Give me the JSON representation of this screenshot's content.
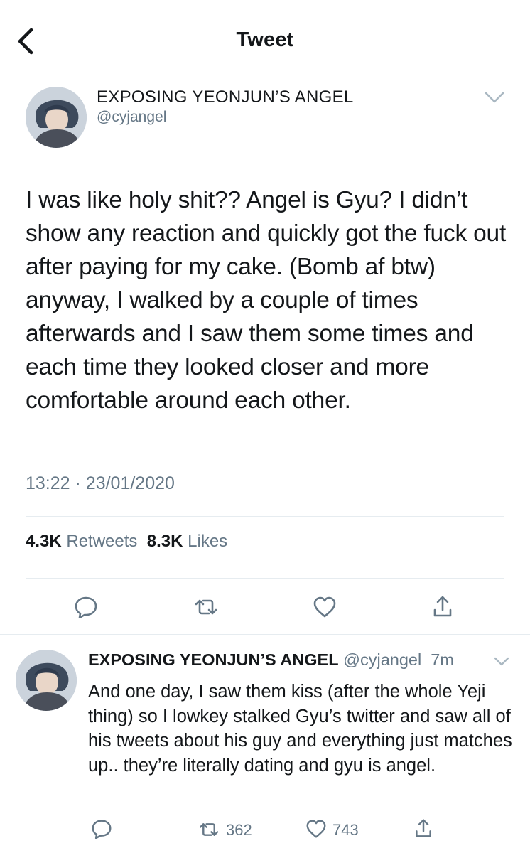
{
  "header": {
    "title": "Tweet",
    "back_icon": "chevron-left-icon"
  },
  "tweet": {
    "author_name": "EXPOSING YEONJUN’S ANGEL",
    "author_handle": "@cyjangel",
    "text": "I was like holy shit?? Angel is Gyu? I didn’t show any reaction and quickly got the fuck out after paying for my cake. (Bomb af btw) anyway, I walked by a couple of times afterwards and I saw them some times and each time they looked closer and more comfortable around each other.",
    "time": "13:22",
    "separator": "·",
    "date": "23/01/2020",
    "retweets_count": "4.3K",
    "retweets_label": "Retweets",
    "likes_count": "8.3K",
    "likes_label": "Likes"
  },
  "reply": {
    "author_name": "EXPOSING YEONJUN’S ANGEL",
    "author_handle": "@cyjangel",
    "time": "7m",
    "text": "And one day, I saw them kiss (after the whole Yeji thing) so I lowkey stalked Gyu’s twitter and saw all of his tweets about his guy and everything just matches up.. they’re literally dating and gyu is angel.",
    "retweet_count": "362",
    "like_count": "743"
  },
  "colors": {
    "text": "#14171a",
    "secondary": "#657786",
    "divider": "#e6ecf0",
    "icon": "#657786"
  },
  "icons": [
    "chevron-left-icon",
    "chevron-down-icon",
    "reply-icon",
    "retweet-icon",
    "like-icon",
    "share-icon",
    "avatar"
  ]
}
